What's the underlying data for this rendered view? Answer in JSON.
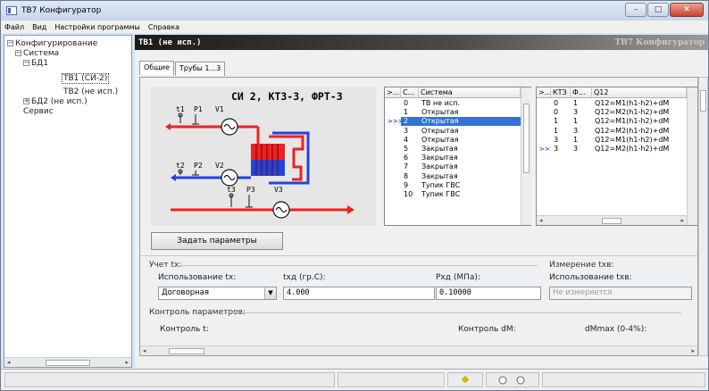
{
  "window": {
    "title": "ТВ7 Конфигуратор"
  },
  "menu": [
    "Файл",
    "Вид",
    "Настройки программы",
    "Справка"
  ],
  "tree": {
    "root": "Конфигурирование",
    "system": "Система",
    "bd1": "БД1",
    "tv1": "ТВ1 (СИ-2)",
    "tv2": "ТВ2 (не исп.)",
    "bd2": "БД2 (не исп.)",
    "service": "Сервис"
  },
  "header": {
    "title": "ТВ1 (не исп.)",
    "app": "ТВ7 Конфигуратор"
  },
  "tabs": [
    "Общие",
    "Трубы 1...3"
  ],
  "schema": {
    "caption": "СИ 2, КТЗ-3, ФРТ-3",
    "t1": "t1",
    "p1": "P1",
    "v1": "V1",
    "t2": "t2",
    "p2": "P2",
    "v2": "V2",
    "t3": "t3",
    "p3": "P3",
    "v3": "V3"
  },
  "systems_table": {
    "headers": [
      ">...",
      "С...",
      "Система"
    ],
    "rows": [
      [
        "",
        "0",
        "ТВ не исп."
      ],
      [
        "",
        "1",
        "Открытая"
      ],
      [
        ">>>",
        "2",
        "Открытая"
      ],
      [
        "",
        "3",
        "Открытая"
      ],
      [
        "",
        "4",
        "Открытая"
      ],
      [
        "",
        "5",
        "Закрытая"
      ],
      [
        "",
        "6",
        "Закрытая"
      ],
      [
        "",
        "7",
        "Закрытая"
      ],
      [
        "",
        "8",
        "Закрытая"
      ],
      [
        "",
        "9",
        "Тупик ГВС"
      ],
      [
        "",
        "10",
        "Тупик ГВС"
      ]
    ]
  },
  "kt_table": {
    "headers": [
      ">...",
      "КТЗ",
      "Ф...",
      "Q12"
    ],
    "rows": [
      [
        "",
        "0",
        "1",
        "Q12=M1(h1-h2)+dM"
      ],
      [
        "",
        "0",
        "3",
        "Q12=M2(h1-h2)+dM"
      ],
      [
        "",
        "1",
        "1",
        "Q12=M1(h1-h2)+dM"
      ],
      [
        "",
        "1",
        "3",
        "Q12=M2(h1-h2)+dM"
      ],
      [
        "",
        "3",
        "1",
        "Q12=M1(h1-h2)+dM"
      ],
      [
        ">>>",
        "3",
        "3",
        "Q12=M2(h1-h2)+dM"
      ]
    ]
  },
  "buttons": {
    "set_params": "Задать параметры"
  },
  "tx": {
    "group": "Учет tх:",
    "usage_label": "Использование tх:",
    "usage_value": "Договорная",
    "txd_label": "txд (гр.С):",
    "txd_value": "4.000",
    "pxd_label": "Рхд (МПа):",
    "pxd_value": "0.10000"
  },
  "thv": {
    "group": "Измерение tхв:",
    "usage_label": "Использование tхв:",
    "usage_value": "Не измеряется"
  },
  "control": {
    "group": "Контроль параметров:",
    "t_label": "Контроль t:",
    "dm_label": "Контроль dM:",
    "dmmax_label": "dMmax (0-4%):"
  },
  "colors": {
    "hot": "#ee2222",
    "cold": "#2244dd",
    "selection": "#3272d4"
  }
}
